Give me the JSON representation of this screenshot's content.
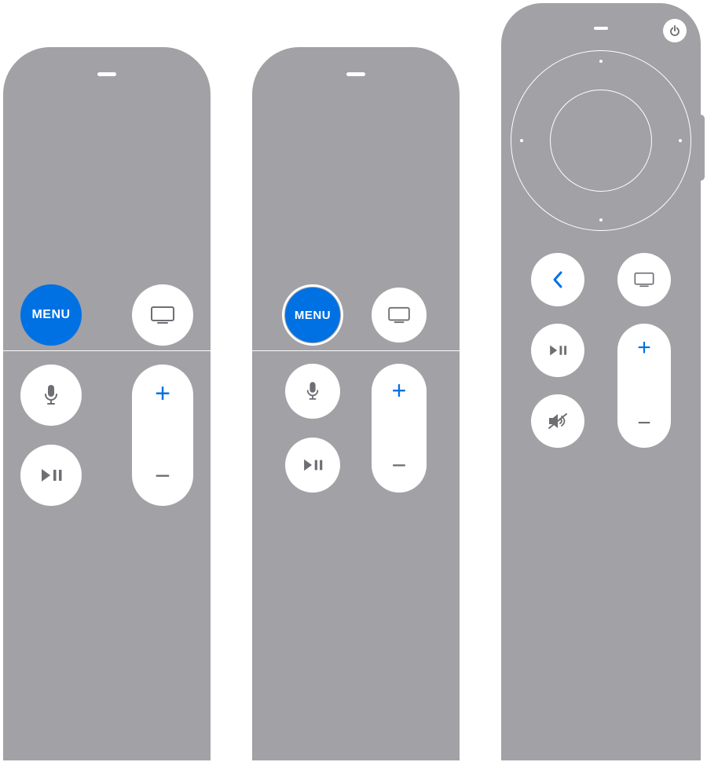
{
  "colors": {
    "remote_body": "#a1a1a6",
    "button_bg": "#ffffff",
    "accent": "#0071e3",
    "icon_gray": "#6e6e73"
  },
  "remotes": [
    {
      "id": "siri-remote-gen1",
      "menu_button": {
        "label": "MENU",
        "highlighted": true
      },
      "tv_button": {
        "icon": "tv-icon"
      },
      "mic_button": {
        "icon": "microphone-icon"
      },
      "playpause_button": {
        "icon": "play-pause-icon"
      },
      "volume": {
        "up_symbol": "+",
        "down_symbol": "−"
      }
    },
    {
      "id": "siri-remote-gen1-alt",
      "menu_button": {
        "label": "MENU",
        "highlighted": true,
        "ring": true
      },
      "tv_button": {
        "icon": "tv-icon"
      },
      "mic_button": {
        "icon": "microphone-icon"
      },
      "playpause_button": {
        "icon": "play-pause-icon"
      },
      "volume": {
        "up_symbol": "+",
        "down_symbol": "−"
      }
    },
    {
      "id": "siri-remote-gen2",
      "power_button": {
        "icon": "power-icon"
      },
      "clickpad": {
        "type": "ring-with-center"
      },
      "back_button": {
        "icon": "chevron-left-icon",
        "highlighted": true
      },
      "tv_button": {
        "icon": "tv-icon"
      },
      "playpause_button": {
        "icon": "play-pause-icon"
      },
      "mute_button": {
        "icon": "mute-icon"
      },
      "volume": {
        "up_symbol": "+",
        "down_symbol": "−",
        "up_highlighted": true
      }
    }
  ]
}
